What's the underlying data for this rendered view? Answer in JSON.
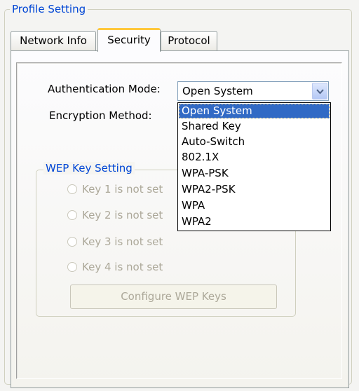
{
  "group_title": "Profile Setting",
  "tabs": [
    {
      "label": "Network Info",
      "active": false
    },
    {
      "label": "Security",
      "active": true
    },
    {
      "label": "Protocol",
      "active": false
    }
  ],
  "security": {
    "auth_mode_label": "Authentication Mode:",
    "auth_mode_value": "Open System",
    "encryption_label": "Encryption Method:",
    "dropdown_options": [
      "Open System",
      "Shared Key",
      "Auto-Switch",
      "802.1X",
      "WPA-PSK",
      "WPA2-PSK",
      "WPA",
      "WPA2"
    ],
    "dropdown_selected_index": 0,
    "wep": {
      "title": "WEP Key Setting",
      "keys": [
        "Key 1 is not set",
        "Key 2 is not set",
        "Key 3 is not set",
        "Key 4 is not set"
      ],
      "configure_button": "Configure WEP Keys",
      "disabled": true
    }
  },
  "colors": {
    "group_title": "#0046d5",
    "active_tab_highlight": "#ffc83c",
    "selection": "#316ac5",
    "disabled_text": "#aca899"
  },
  "icons": {
    "combo_arrow": "chevron-down-icon"
  }
}
